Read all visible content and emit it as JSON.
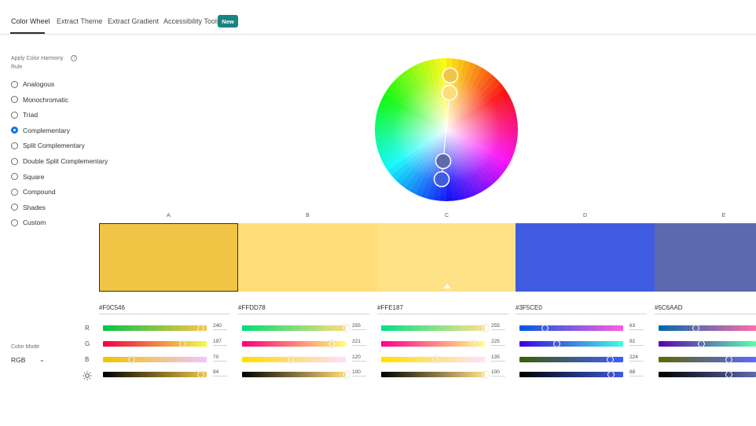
{
  "tabs": {
    "color_wheel": "Color Wheel",
    "extract_theme": "Extract Theme",
    "extract_gradient": "Extract Gradient",
    "accessibility_tools": "Accessibility Tools",
    "new_badge": "New"
  },
  "harmony": {
    "title": "Apply Color Harmony Rule",
    "info_icon": "info-icon",
    "rules": [
      "Analogous",
      "Monochromatic",
      "Triad",
      "Complementary",
      "Split Complementary",
      "Double Split Complementary",
      "Square",
      "Compound",
      "Shades",
      "Custom"
    ],
    "selected": "Complementary"
  },
  "color_mode": {
    "label": "Color Mode",
    "value": "RGB"
  },
  "channel_labels": [
    "R",
    "G",
    "B"
  ],
  "brightness_icon": "sun-icon",
  "swatches": [
    {
      "label": "A",
      "hex": "#F0C546",
      "color": "#F0C546",
      "rgb": [
        240,
        197,
        70
      ],
      "brightness": 94,
      "selected": true
    },
    {
      "label": "B",
      "hex": "#FFDD78",
      "color": "#FFDD78",
      "rgb": [
        255,
        221,
        120
      ],
      "brightness": 100
    },
    {
      "label": "C",
      "hex": "#FFE187",
      "color": "#FFE187",
      "rgb": [
        255,
        225,
        135
      ],
      "brightness": 100
    },
    {
      "label": "D",
      "hex": "#3F5CE0",
      "color": "#3F5CE0",
      "rgb": [
        63,
        92,
        224
      ],
      "brightness": 88
    },
    {
      "label": "E",
      "hex": "#5C6AAD",
      "color": "#5C6AAD",
      "rgb": [
        92,
        106,
        173
      ],
      "brightness": 68
    }
  ],
  "colors": {
    "accent": "#1473E6",
    "badge": "#1A8480"
  }
}
